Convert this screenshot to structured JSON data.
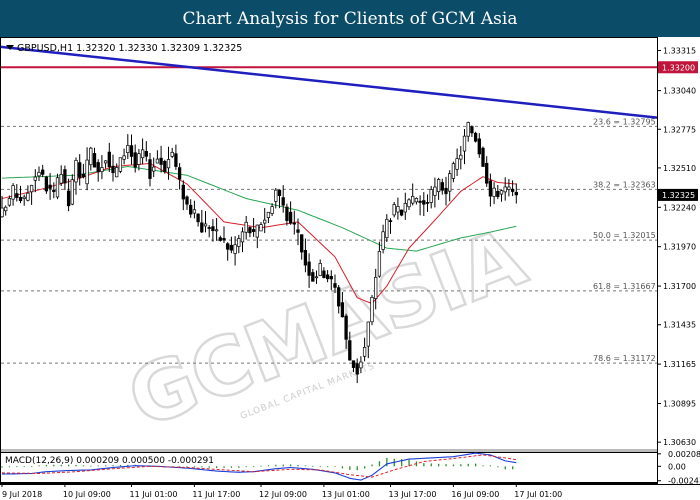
{
  "page": {
    "title": "Chart Analysis for Clients of GCM Asia"
  },
  "watermark": {
    "main": "GCMASIA",
    "small": "GLOBAL CAPITAL MARKETS"
  },
  "colors": {
    "title_bg": "#0b4c68",
    "bull": "#ffffff",
    "bear": "#000000",
    "trendline": "#1f1fbf",
    "resistance": "#c0143c",
    "ma_fast": "#d9202a",
    "ma_slow": "#2aa654",
    "fib": "#777777",
    "price_tag_bg": "#000000",
    "resistance_tag_bg": "#c0143c",
    "macd_line": "#1a3fd6",
    "macd_signal": "#e0202a",
    "macd_hist": "#2a8f2a"
  },
  "chart_data": [
    {
      "type": "candlestick",
      "header": "GBPUSD,H1  1.32320 1.32330 1.32309 1.32325",
      "y_ticks": [
        "1.33315",
        "1.33040",
        "1.32775",
        "1.32510",
        "1.32240",
        "1.31970",
        "1.31700",
        "1.31435",
        "1.31165",
        "1.30895",
        "1.30630"
      ],
      "ylim": [
        1.3059,
        1.3338
      ],
      "x_ticks": [
        "9 Jul 2018",
        "10 Jul 09:00",
        "11 Jul 01:00",
        "11 Jul 17:00",
        "12 Jul 09:00",
        "13 Jul 01:00",
        "13 Jul 17:00",
        "16 Jul 09:00",
        "17 Jul 01:00"
      ],
      "current_price": "1.32325",
      "resistance_level": {
        "label": "1.33200",
        "value": 1.332
      },
      "fib_levels": [
        {
          "label": "23.6 = 1.32795",
          "value": 1.32795
        },
        {
          "label": "38.2 = 1.32363",
          "value": 1.32363
        },
        {
          "label": "50.0 = 1.32015",
          "value": 1.32015
        },
        {
          "label": "61.8 = 1.31667",
          "value": 1.31667
        },
        {
          "label": "78.6 = 1.31172",
          "value": 1.31172
        }
      ],
      "trendline": {
        "start": 1.3334,
        "end": 1.32855
      },
      "close_path": [
        [
          0,
          1.322
        ],
        [
          3,
          1.3235
        ],
        [
          6,
          1.3228
        ],
        [
          8,
          1.3242
        ],
        [
          10,
          1.325
        ],
        [
          12,
          1.3238
        ],
        [
          14,
          1.3232
        ],
        [
          16,
          1.3248
        ],
        [
          18,
          1.3226
        ],
        [
          20,
          1.3254
        ],
        [
          22,
          1.3242
        ],
        [
          24,
          1.3262
        ],
        [
          26,
          1.325
        ],
        [
          28,
          1.326
        ],
        [
          30,
          1.3246
        ],
        [
          32,
          1.3255
        ],
        [
          34,
          1.3268
        ],
        [
          36,
          1.3252
        ],
        [
          38,
          1.3262
        ],
        [
          40,
          1.3248
        ],
        [
          42,
          1.3258
        ],
        [
          44,
          1.3252
        ],
        [
          46,
          1.3262
        ],
        [
          48,
          1.324
        ],
        [
          50,
          1.3226
        ],
        [
          52,
          1.3218
        ],
        [
          54,
          1.321
        ],
        [
          56,
          1.3212
        ],
        [
          58,
          1.3205
        ],
        [
          60,
          1.32
        ],
        [
          62,
          1.3194
        ],
        [
          64,
          1.3202
        ],
        [
          66,
          1.3212
        ],
        [
          68,
          1.3204
        ],
        [
          70,
          1.3214
        ],
        [
          72,
          1.322
        ],
        [
          74,
          1.3236
        ],
        [
          76,
          1.3226
        ],
        [
          78,
          1.3212
        ],
        [
          80,
          1.3205
        ],
        [
          82,
          1.3186
        ],
        [
          84,
          1.3176
        ],
        [
          86,
          1.3182
        ],
        [
          88,
          1.3177
        ],
        [
          90,
          1.3168
        ],
        [
          92,
          1.315
        ],
        [
          94,
          1.3118
        ],
        [
          96,
          1.3112
        ],
        [
          98,
          1.3128
        ],
        [
          100,
          1.316
        ],
        [
          102,
          1.3195
        ],
        [
          104,
          1.3215
        ],
        [
          106,
          1.3222
        ],
        [
          108,
          1.322
        ],
        [
          110,
          1.3225
        ],
        [
          112,
          1.323
        ],
        [
          114,
          1.3226
        ],
        [
          116,
          1.3232
        ],
        [
          118,
          1.324
        ],
        [
          120,
          1.3236
        ],
        [
          122,
          1.325
        ],
        [
          124,
          1.3262
        ],
        [
          126,
          1.328
        ],
        [
          128,
          1.3272
        ],
        [
          130,
          1.3256
        ],
        [
          132,
          1.3232
        ],
        [
          134,
          1.3235
        ],
        [
          136,
          1.3237
        ],
        [
          138,
          1.3233
        ],
        [
          139,
          1.32325
        ]
      ],
      "ma_fast_path": [
        [
          0,
          1.323
        ],
        [
          10,
          1.3236
        ],
        [
          20,
          1.3243
        ],
        [
          30,
          1.3252
        ],
        [
          40,
          1.3254
        ],
        [
          50,
          1.324
        ],
        [
          60,
          1.3214
        ],
        [
          70,
          1.321
        ],
        [
          80,
          1.3214
        ],
        [
          90,
          1.319
        ],
        [
          96,
          1.3162
        ],
        [
          100,
          1.3158
        ],
        [
          104,
          1.317
        ],
        [
          110,
          1.3196
        ],
        [
          118,
          1.3218
        ],
        [
          124,
          1.3235
        ],
        [
          130,
          1.3245
        ],
        [
          134,
          1.3241
        ],
        [
          139,
          1.324
        ]
      ],
      "ma_slow_path": [
        [
          0,
          1.3244
        ],
        [
          20,
          1.3246
        ],
        [
          34,
          1.3252
        ],
        [
          50,
          1.3246
        ],
        [
          66,
          1.323
        ],
        [
          80,
          1.3222
        ],
        [
          92,
          1.321
        ],
        [
          104,
          1.3196
        ],
        [
          112,
          1.3194
        ],
        [
          124,
          1.3203
        ],
        [
          132,
          1.3207
        ],
        [
          139,
          1.3211
        ]
      ]
    },
    {
      "type": "bar",
      "header": "MACD(12,26,9) 0.000209 0.000500 -0.000291",
      "y_ticks": [
        "0.00208",
        "0.00",
        "-0.00241"
      ],
      "ylim": [
        -0.00262,
        0.00222
      ],
      "line_path": [
        [
          0,
          -0.0013
        ],
        [
          8,
          -0.0012
        ],
        [
          12,
          -0.0009
        ],
        [
          18,
          -0.0007
        ],
        [
          24,
          -0.0006
        ],
        [
          30,
          -0.0002
        ],
        [
          36,
          0.0001
        ],
        [
          42,
          0.0
        ],
        [
          50,
          -0.0003
        ],
        [
          58,
          -0.0008
        ],
        [
          64,
          -0.001
        ],
        [
          68,
          -0.0009
        ],
        [
          74,
          -0.0004
        ],
        [
          78,
          -0.0002
        ],
        [
          84,
          -0.0005
        ],
        [
          90,
          -0.0011
        ],
        [
          94,
          -0.002
        ],
        [
          97,
          -0.0023
        ],
        [
          100,
          -0.0015
        ],
        [
          104,
          0.0004
        ],
        [
          110,
          0.0012
        ],
        [
          116,
          0.0014
        ],
        [
          122,
          0.0016
        ],
        [
          128,
          0.0022
        ],
        [
          132,
          0.0019
        ],
        [
          136,
          0.0009
        ],
        [
          139,
          0.0006
        ]
      ],
      "signal_path": [
        [
          0,
          -0.0011
        ],
        [
          10,
          -0.0012
        ],
        [
          20,
          -0.0009
        ],
        [
          30,
          -0.0004
        ],
        [
          40,
          0.0
        ],
        [
          50,
          -0.0002
        ],
        [
          60,
          -0.0006
        ],
        [
          68,
          -0.0009
        ],
        [
          78,
          -0.0005
        ],
        [
          86,
          -0.0006
        ],
        [
          94,
          -0.0014
        ],
        [
          100,
          -0.0018
        ],
        [
          106,
          -0.0006
        ],
        [
          114,
          0.0008
        ],
        [
          122,
          0.0013
        ],
        [
          130,
          0.0019
        ],
        [
          136,
          0.0014
        ],
        [
          139,
          0.0011
        ]
      ]
    }
  ]
}
